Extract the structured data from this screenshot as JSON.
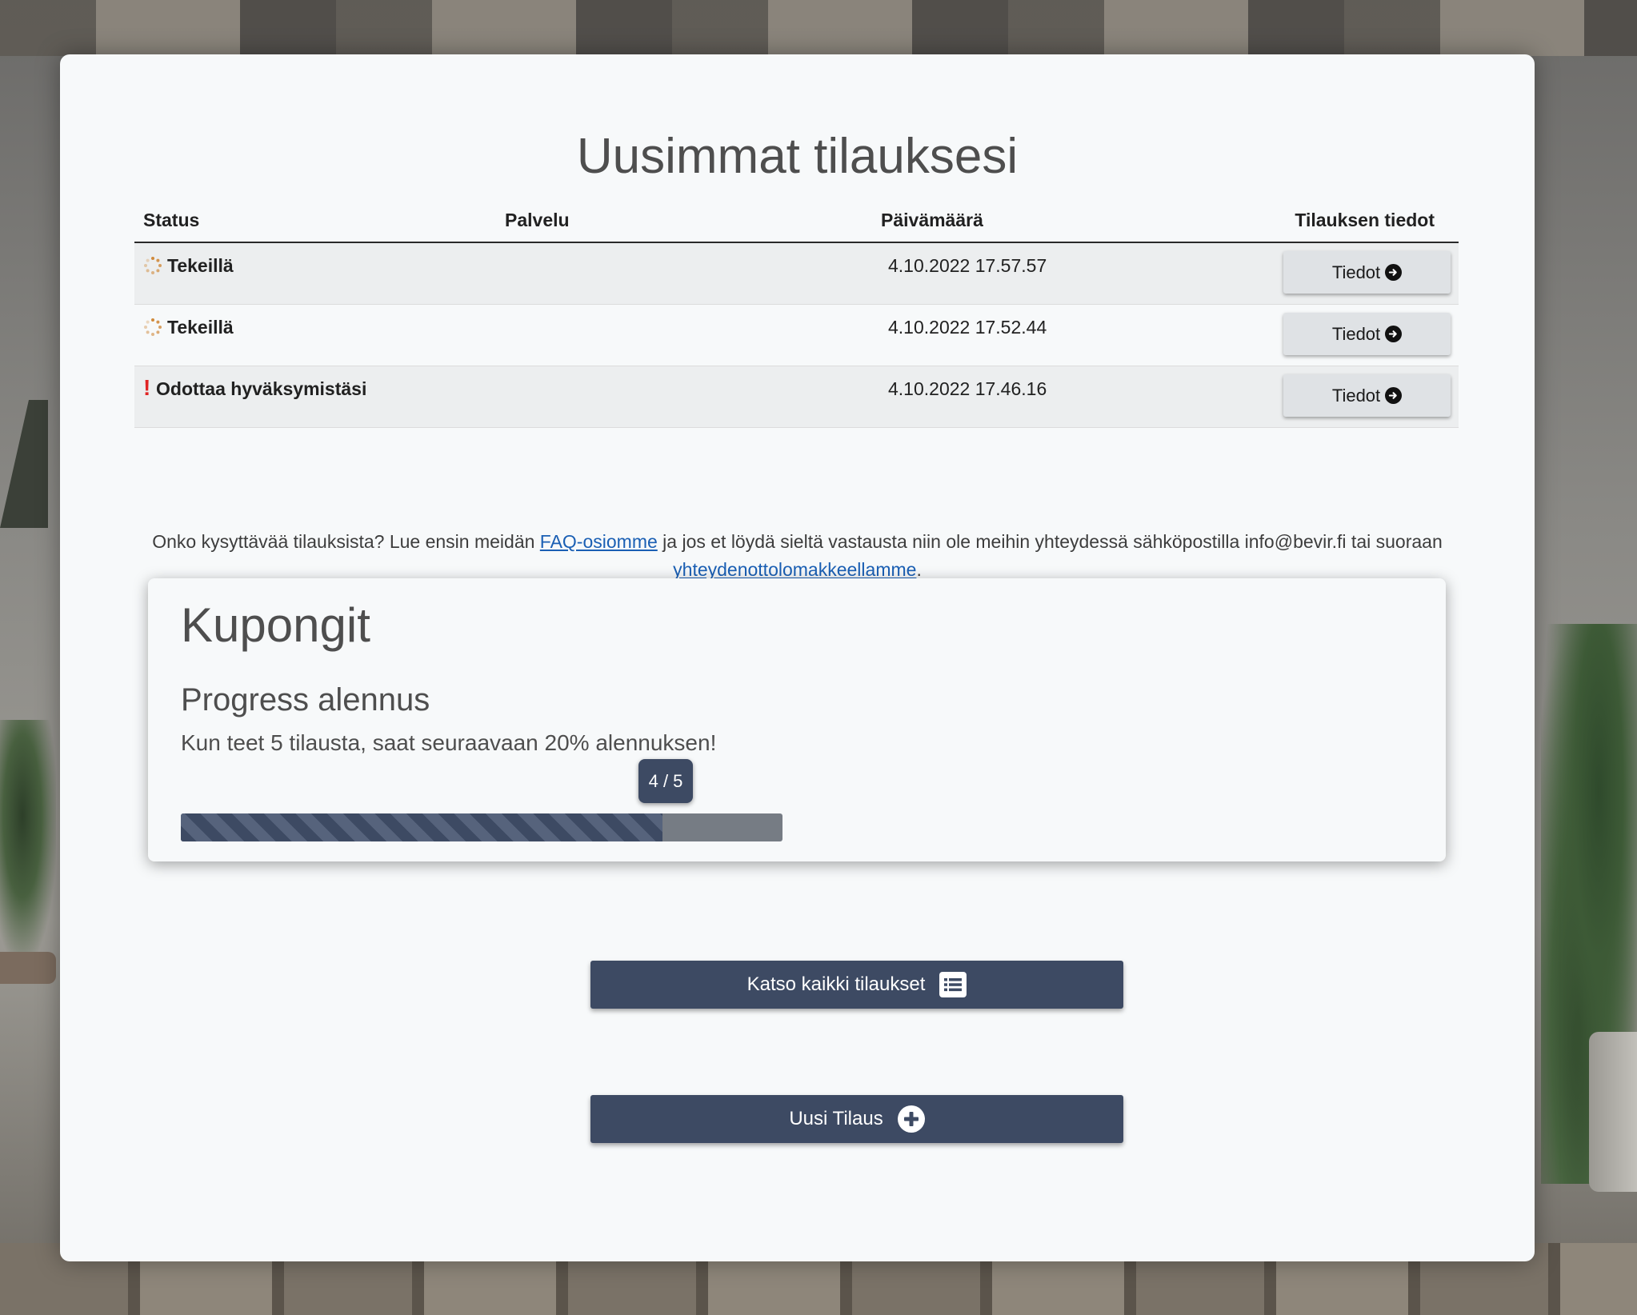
{
  "page": {
    "title": "Uusimmat tilauksesi"
  },
  "table": {
    "headers": {
      "status": "Status",
      "service": "Palvelu",
      "date": "Päivämäärä",
      "info": "Tilauksen tiedot"
    },
    "rows": [
      {
        "status": "Tekeillä",
        "status_icon": "spinner-icon",
        "service": "",
        "date": "4.10.2022 17.57.57",
        "button": "Tiedot"
      },
      {
        "status": "Tekeillä",
        "status_icon": "spinner-icon",
        "service": "",
        "date": "4.10.2022 17.52.44",
        "button": "Tiedot"
      },
      {
        "status": "Odottaa hyväksymistäsi",
        "status_icon": "exclamation-icon",
        "service": "",
        "date": "4.10.2022 17.46.16",
        "button": "Tiedot"
      }
    ]
  },
  "faq": {
    "before_link": "Onko kysyttävää tilauksista? Lue ensin meidän ",
    "faq_link": "FAQ-osiomme",
    "middle": " ja jos et löydä sieltä vastausta niin ole meihin yhteydessä sähköpostilla info@bevir.fi tai suoraan ",
    "contact_link": "yhteydenottolomakkeellamme",
    "after": "."
  },
  "coupons": {
    "title": "Kupongit",
    "coupon_name": "Progress alennus",
    "description": "Kun teet 5 tilausta, saat seuraavaan 20% alennuksen!",
    "progress_label": "4 / 5",
    "progress_current": 4,
    "progress_total": 5
  },
  "actions": {
    "view_all": "Katso kaikki tilaukset",
    "new_order": "Uusi Tilaus"
  },
  "colors": {
    "primary": "#3d4a63",
    "link": "#1a5fb4",
    "alert": "#e02424",
    "spinner": "#d08a3c"
  }
}
